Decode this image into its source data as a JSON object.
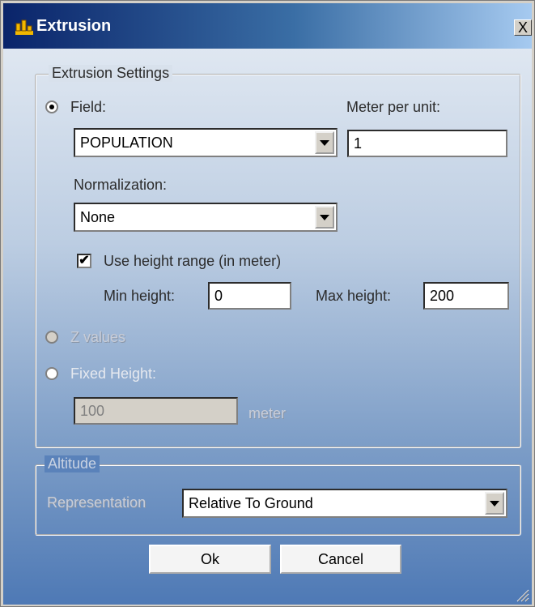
{
  "window": {
    "title": "Extrusion",
    "close_label": "X"
  },
  "extrusion": {
    "group_title": "Extrusion Settings",
    "field_label": "Field:",
    "field_value": "POPULATION",
    "meter_per_unit_label": "Meter per unit:",
    "meter_per_unit_value": "1",
    "normalization_label": "Normalization:",
    "normalization_value": "None",
    "use_height_range_label": "Use height range (in meter)",
    "use_height_range_checked": true,
    "min_height_label": "Min height:",
    "min_height_value": "0",
    "max_height_label": "Max height:",
    "max_height_value": "200",
    "z_values_label": "Z values",
    "fixed_height_label": "Fixed Height:",
    "fixed_height_value": "100",
    "fixed_height_unit": "meter"
  },
  "altitude": {
    "group_title": "Altitude",
    "representation_label": "Representation",
    "representation_value": "Relative To Ground"
  },
  "buttons": {
    "ok": "Ok",
    "cancel": "Cancel"
  }
}
